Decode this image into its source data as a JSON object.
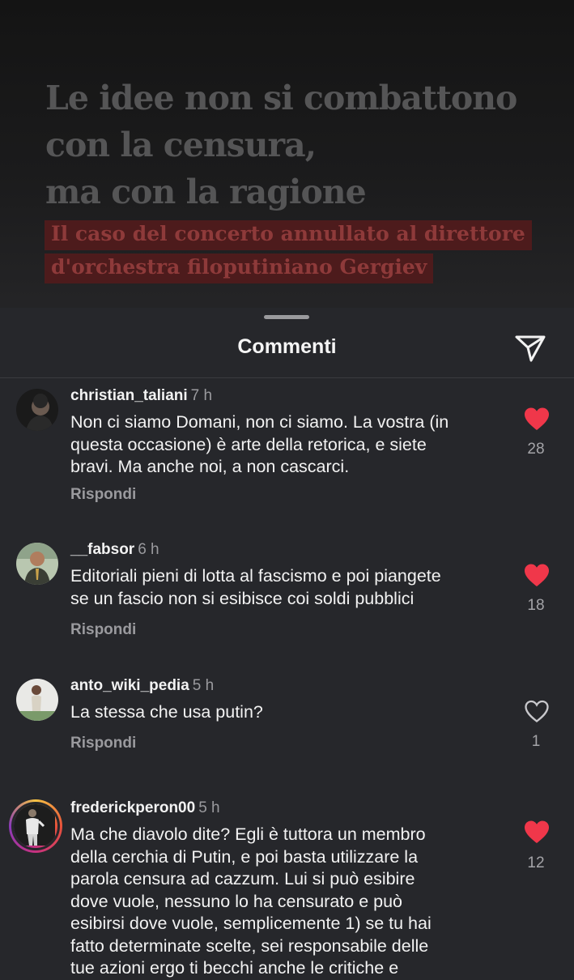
{
  "post": {
    "title_lines": [
      "Le idee non si combattono",
      "con la censura,",
      "ma con la ragione"
    ],
    "subtitle_lines": [
      "Il caso del concerto annullato al direttore",
      "d'orchestra filoputiniano Gergiev"
    ]
  },
  "sheet": {
    "title": "Commenti",
    "share_icon": "send-icon"
  },
  "colors": {
    "background": "#26272b",
    "like_red": "#f0374a",
    "muted": "#9a9a9e"
  },
  "comments": [
    {
      "username": "christian_taliani",
      "time": "7 h",
      "lines": [
        "Non ci siamo Domani, non ci siamo. La vostra (in",
        "questa occasione) è arte della retorica, e siete",
        "bravi. Ma anche noi, a non cascarci."
      ],
      "reply": "Rispondi",
      "liked": true,
      "likes": "28"
    },
    {
      "username": "__fabsor",
      "time": "6 h",
      "lines": [
        "Editoriali pieni di lotta al fascismo e poi piangete",
        "se un fascio non si esibisce coi soldi pubblici"
      ],
      "reply": "Rispondi",
      "liked": true,
      "likes": "18"
    },
    {
      "username": "anto_wiki_pedia",
      "time": "5 h",
      "lines": [
        "La stessa che usa putin?"
      ],
      "reply": "Rispondi",
      "liked": false,
      "likes": "1"
    },
    {
      "username": "frederickperon00",
      "time": "5 h",
      "lines": [
        "Ma che diavolo dite? Egli è tuttora un membro",
        "della cerchia di Putin, e poi basta utilizzare la",
        "parola censura ad cazzum. Lui si può esibire",
        "dove vuole, nessuno lo ha censurato e può",
        "esibirsi dove vuole, semplicemente 1) se tu hai",
        "fatto determinate scelte, sei responsabile delle",
        "tue azioni ergo ti becchi anche le critiche e"
      ],
      "reply": "",
      "liked": true,
      "likes": "12"
    }
  ]
}
